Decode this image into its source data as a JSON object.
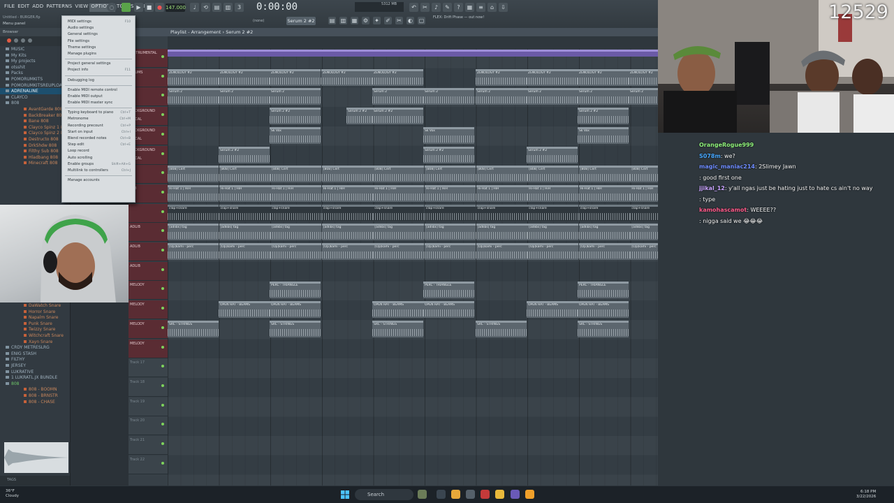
{
  "menubar": [
    "FILE",
    "EDIT",
    "ADD",
    "PATTERNS",
    "VIEW",
    "OPTIONS",
    "TOOLS",
    "HELP"
  ],
  "project": {
    "title": "Untitled - BURGER.flp",
    "hint": "Menu panel"
  },
  "transport": {
    "tempo": "147.000",
    "time": "0:00:00",
    "cpu_label": "5312 MB",
    "pattern": "Serum 2 #2",
    "mode": "(none)",
    "news": "FLEX: Drift Phase — out now!"
  },
  "options_menu": {
    "items": [
      {
        "label": "MIDI settings",
        "shortcut": "F10"
      },
      {
        "label": "Audio settings",
        "shortcut": ""
      },
      {
        "label": "General settings",
        "shortcut": ""
      },
      {
        "label": "File settings",
        "shortcut": ""
      },
      {
        "label": "Theme settings",
        "shortcut": ""
      },
      {
        "label": "Manage plugins",
        "shortcut": ""
      },
      {
        "sep": true
      },
      {
        "label": "Project general settings",
        "shortcut": ""
      },
      {
        "label": "Project info",
        "shortcut": "F11"
      },
      {
        "sep": true
      },
      {
        "label": "Debugging log",
        "shortcut": ""
      },
      {
        "sep": true
      },
      {
        "label": "Enable MIDI remote control",
        "shortcut": ""
      },
      {
        "label": "Enable MIDI output",
        "shortcut": ""
      },
      {
        "label": "Enable MIDI master sync",
        "shortcut": ""
      },
      {
        "sep": true
      },
      {
        "label": "Typing keyboard to piano",
        "shortcut": "Ctrl+T"
      },
      {
        "label": "Metronome",
        "shortcut": "Ctrl+M"
      },
      {
        "label": "Recording precount",
        "shortcut": "Ctrl+P"
      },
      {
        "label": "Start on input",
        "shortcut": "Ctrl+I"
      },
      {
        "label": "Blend recorded notes",
        "shortcut": "Ctrl+B"
      },
      {
        "label": "Step edit",
        "shortcut": "Ctrl+E"
      },
      {
        "label": "Loop record",
        "shortcut": ""
      },
      {
        "label": "Auto scrolling",
        "shortcut": ""
      },
      {
        "label": "Enable groups",
        "shortcut": "Shift+Alt+G"
      },
      {
        "label": "Multilink to controllers",
        "shortcut": "Ctrl+J"
      },
      {
        "sep": true
      },
      {
        "label": "Manage accounts",
        "shortcut": ""
      }
    ]
  },
  "browser": {
    "header": "Browser",
    "items": [
      {
        "label": "MUSIC",
        "kind": "folder"
      },
      {
        "label": "My Kits",
        "kind": "folder"
      },
      {
        "label": "My projects",
        "kind": "folder"
      },
      {
        "label": "otsshit",
        "kind": "folder"
      },
      {
        "label": "Packs",
        "kind": "folder"
      },
      {
        "label": "POMORUMKITS",
        "kind": "folder"
      },
      {
        "label": "POMORUMKITSREUPLOAD",
        "kind": "folder"
      },
      {
        "label": "ADRENALINE",
        "kind": "hl"
      },
      {
        "label": "CLAYCO",
        "kind": "folder"
      },
      {
        "label": "808",
        "kind": "folder"
      },
      {
        "label": "AvantGarde 808",
        "kind": "sub"
      },
      {
        "label": "BackBreaker 808",
        "kind": "sub"
      },
      {
        "label": "Bane 808",
        "kind": "sub"
      },
      {
        "label": "Clayco Spinz 1 808",
        "kind": "sub"
      },
      {
        "label": "Clayco Spinz 2 808",
        "kind": "sub"
      },
      {
        "label": "Destructo 808",
        "kind": "sub"
      },
      {
        "label": "DrkShdw 808",
        "kind": "sub"
      },
      {
        "label": "Filthy Sub 808",
        "kind": "sub"
      },
      {
        "label": "Hladbang 808",
        "kind": "sub"
      },
      {
        "label": "Minecraft 808",
        "kind": "sub"
      }
    ],
    "items2": [
      {
        "label": "DaWatch Snare",
        "kind": "sub"
      },
      {
        "label": "Horror Snare",
        "kind": "sub"
      },
      {
        "label": "Napalm Snare",
        "kind": "sub"
      },
      {
        "label": "Punk Snare",
        "kind": "sub"
      },
      {
        "label": "Twizzy Snare",
        "kind": "sub"
      },
      {
        "label": "Witchcraft Snare",
        "kind": "sub"
      },
      {
        "label": "Xayn Snare",
        "kind": "sub"
      },
      {
        "label": "CRDY METRESLRG",
        "kind": "folder"
      },
      {
        "label": "ENIG STASH",
        "kind": "folder"
      },
      {
        "label": "FILTHY",
        "kind": "folder"
      },
      {
        "label": "JERSEY",
        "kind": "folder"
      },
      {
        "label": "LUKRATIVE",
        "kind": "folder"
      },
      {
        "label": "1 LUKRATL.JX BUNDLE",
        "kind": "folder"
      },
      {
        "label": "808",
        "kind": "green"
      },
      {
        "label": "808 - BOOMN",
        "kind": "sub"
      },
      {
        "label": "808 - BRNSTR",
        "kind": "sub"
      },
      {
        "label": "808 - CHASE",
        "kind": "sub"
      }
    ],
    "tag": "TAGS"
  },
  "playlist": {
    "title": "Playlist - Arrangement › Serum 2 #2",
    "tracks": [
      {
        "label": "INSTRUMENTAL",
        "red": true
      },
      {
        "label": "DRUMS",
        "red": true
      },
      {
        "label": "",
        "red": true
      },
      {
        "label": "BACKGROUND VOCAL",
        "red": true
      },
      {
        "label": "BACKGROUND VOCAL",
        "red": true
      },
      {
        "label": "BACKGROUND VOCAL",
        "red": true
      },
      {
        "label": "",
        "red": true
      },
      {
        "label": "808",
        "red": true
      },
      {
        "label": "",
        "red": true
      },
      {
        "label": "ADLIB",
        "red": true
      },
      {
        "label": "ADLIB",
        "red": true
      },
      {
        "label": "ADLIB",
        "red": true
      },
      {
        "label": "MELODY",
        "red": true
      },
      {
        "label": "MELODY",
        "red": true
      },
      {
        "label": "MELODY",
        "red": true
      },
      {
        "label": "MELODY",
        "red": true
      },
      {
        "label": "Track 17",
        "red": false
      },
      {
        "label": "Track 18",
        "red": false
      },
      {
        "label": "Track 19",
        "red": false
      },
      {
        "label": "Track 20",
        "red": false
      },
      {
        "label": "Track 21",
        "red": false
      },
      {
        "label": "Track 22",
        "red": false
      }
    ],
    "clip_names": {
      "synth": "ZENOLOGY #2",
      "serum": "Serum 2",
      "serum2": "Serum 2 #2",
      "vox": "Sk Vox",
      "kick": "[808] Cert",
      "hat": "Hi-Hat 1 | HiH",
      "clap": "clap+snare",
      "adlib": "[adlibs] tag",
      "perc": "[Op]kami - perc",
      "tri": "PERC - TRIANGLE",
      "ohat": "OPEN HAT - BEAMS",
      "string": "SRC - STRINGS"
    }
  },
  "stream": {
    "counter": "12529",
    "chat": [
      {
        "user": "OrangeRogue999",
        "msg": "",
        "color": "#8ff07a"
      },
      {
        "user": "S078m",
        "msg": "we?",
        "color": "#47a8ff"
      },
      {
        "user": "magic_maniac214",
        "msg": "2Slimey Jawn",
        "color": "#6e8cff"
      },
      {
        "user": "",
        "msg": "good first one",
        "color": "#2a44ff"
      },
      {
        "user": "jjikal_12",
        "msg": "y'all ngas just be hating just to hate cs ain't no way",
        "color": "#c9a3ff"
      },
      {
        "user": "",
        "msg": "type",
        "color": "#ff2a2a"
      },
      {
        "user": "kamohascamot",
        "msg": "WEEEE??",
        "color": "#ff5a8a"
      },
      {
        "user": "",
        "msg": "nigga said we 😂😂😂",
        "color": "#ff2a2a"
      }
    ]
  },
  "taskbar": {
    "weather_temp": "36°F",
    "weather_desc": "Cloudy",
    "search": "Search",
    "time": "6:18 PM",
    "date": "3/22/2026"
  }
}
